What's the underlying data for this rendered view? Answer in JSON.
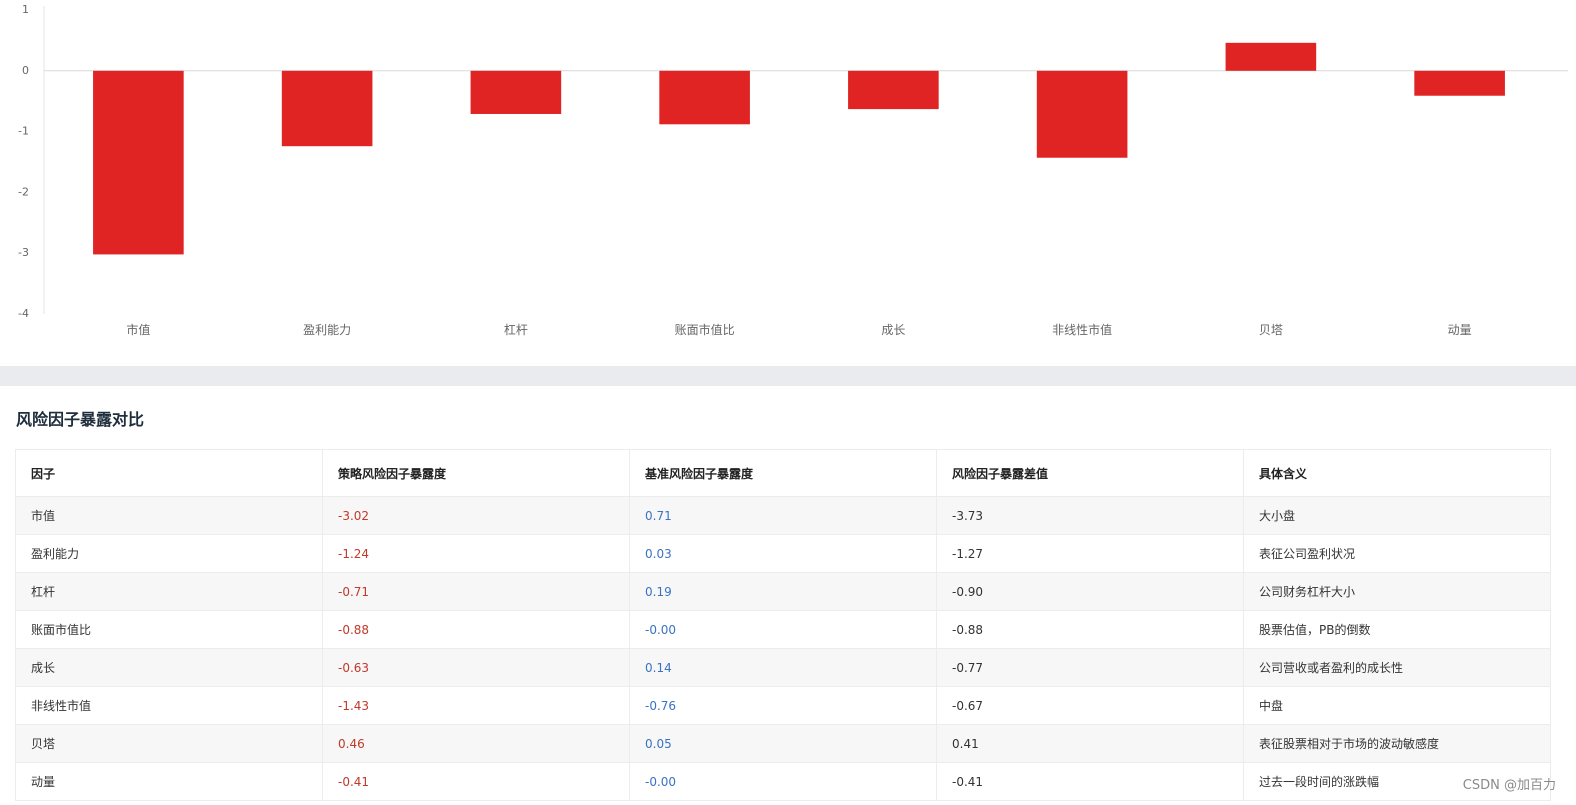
{
  "chart_data": {
    "type": "bar",
    "categories": [
      "市值",
      "盈利能力",
      "杠杆",
      "账面市值比",
      "成长",
      "非线性市值",
      "贝塔",
      "动量"
    ],
    "values": [
      -3.02,
      -1.24,
      -0.71,
      -0.88,
      -0.63,
      -1.43,
      0.46,
      -0.41
    ],
    "yticks": [
      "1",
      "0",
      "-1",
      "-2",
      "-3",
      "-4"
    ],
    "ylim": [
      -4,
      1
    ],
    "grid": false,
    "bar_color": "#e02424",
    "zero_line_color": "#d9d9d9",
    "axis_line_color": "#e6e6e6",
    "title": "",
    "xlabel": "",
    "ylabel": ""
  },
  "section": {
    "title": "风险因子暴露对比"
  },
  "table": {
    "headers": [
      "因子",
      "策略风险因子暴露度",
      "基准风险因子暴露度",
      "风险因子暴露差值",
      "具体含义"
    ],
    "rows": [
      [
        "市值",
        "-3.02",
        "0.71",
        "-3.73",
        "大小盘"
      ],
      [
        "盈利能力",
        "-1.24",
        "0.03",
        "-1.27",
        "表征公司盈利状况"
      ],
      [
        "杠杆",
        "-0.71",
        "0.19",
        "-0.90",
        "公司财务杠杆大小"
      ],
      [
        "账面市值比",
        "-0.88",
        "-0.00",
        "-0.88",
        "股票估值，PB的倒数"
      ],
      [
        "成长",
        "-0.63",
        "0.14",
        "-0.77",
        "公司营收或者盈利的成长性"
      ],
      [
        "非线性市值",
        "-1.43",
        "-0.76",
        "-0.67",
        "中盘"
      ],
      [
        "贝塔",
        "0.46",
        "0.05",
        "0.41",
        "表征股票相对于市场的波动敏感度"
      ],
      [
        "动量",
        "-0.41",
        "-0.00",
        "-0.41",
        "过去一段时间的涨跌幅"
      ]
    ]
  },
  "colors": {
    "strategy_text": "#c0392b",
    "benchmark_text": "#3a72c4"
  },
  "watermark": "CSDN @加百力"
}
